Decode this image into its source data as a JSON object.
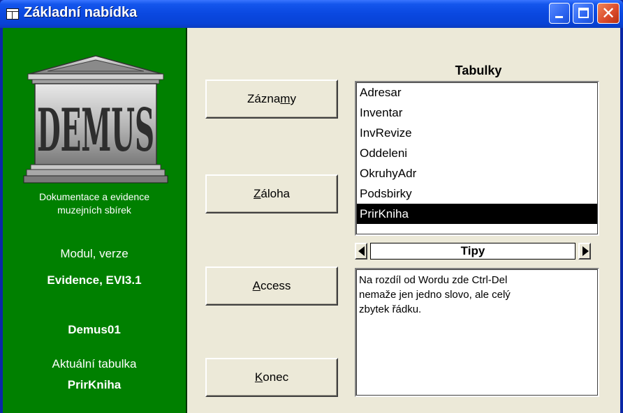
{
  "window": {
    "title": "Základní nabídka"
  },
  "left_panel": {
    "logo_text": "DEMUS",
    "description_line1": "Dokumentace a evidence",
    "description_line2": "muzejních sbírek",
    "modul_label": "Modul, verze",
    "modul_value": "Evidence, EVI3.1",
    "database_name": "Demus01",
    "current_table_label": "Aktuální tabulka",
    "current_table_value": "PrirKniha"
  },
  "buttons": {
    "zaznamy": {
      "pre": "Zázna",
      "accel": "m",
      "post": "y"
    },
    "zaloha": {
      "pre": "",
      "accel": "Z",
      "post": "áloha"
    },
    "access": {
      "pre": "",
      "accel": "A",
      "post": "ccess"
    },
    "konec": {
      "pre": "",
      "accel": "K",
      "post": "onec"
    }
  },
  "tables": {
    "title": "Tabulky",
    "items": [
      "Adresar",
      "Inventar",
      "InvRevize",
      "Oddeleni",
      "OkruhyAdr",
      "Podsbirky",
      "PrirKniha"
    ],
    "selected": "PrirKniha"
  },
  "tips": {
    "title": "Tipy",
    "text_line1": "Na rozdíl od Wordu zde Ctrl-Del",
    "text_line2": "nemaže jen jedno slovo, ale celý",
    "text_line3": "zbytek řádku."
  },
  "colors": {
    "title_bar": "#0a48e0",
    "left_panel": "#008000",
    "client_bg": "#ece9d8",
    "close_button": "#d9492a"
  }
}
